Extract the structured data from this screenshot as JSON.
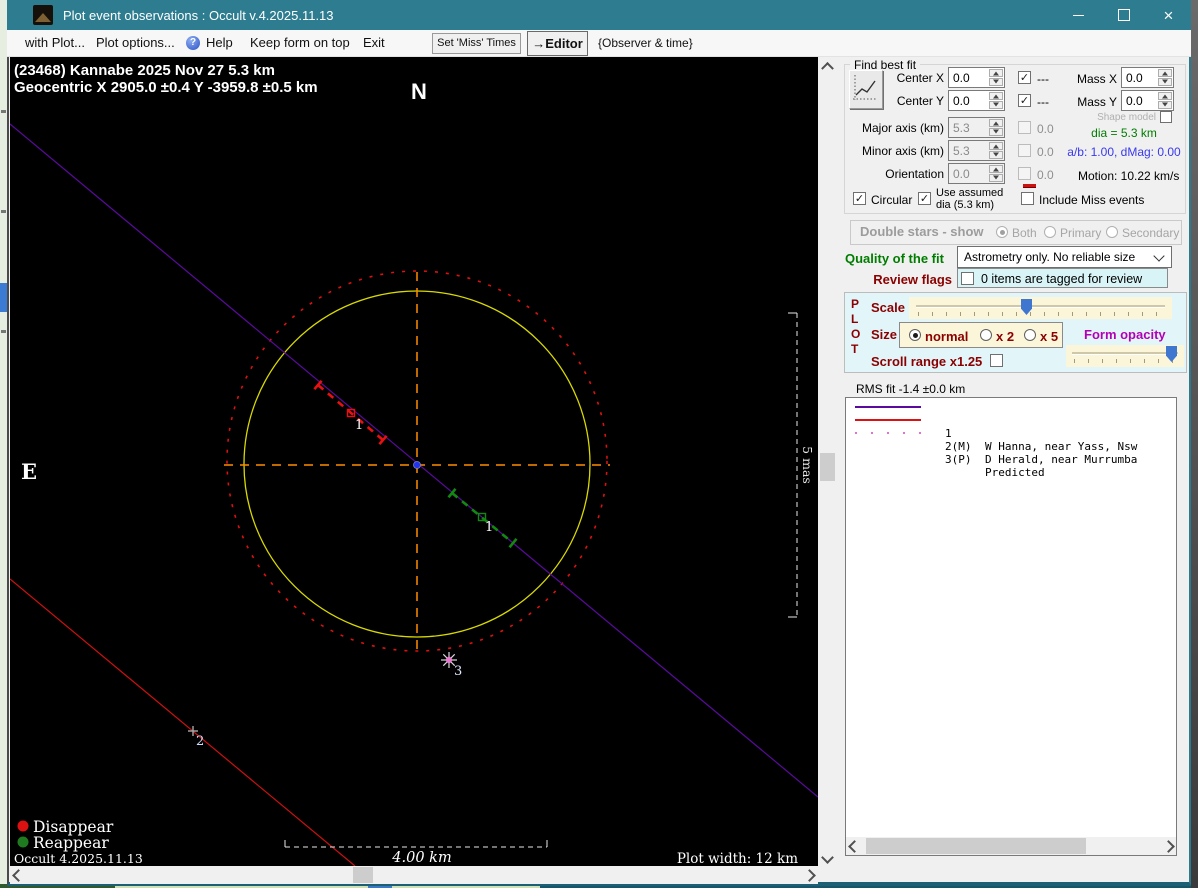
{
  "titlebar": {
    "title": "Plot event observations : Occult v.4.2025.11.13"
  },
  "menu": {
    "with_plot": "with Plot...",
    "plot_options": "Plot options...",
    "help": "Help",
    "keep_on_top": "Keep form on top",
    "exit": "Exit",
    "set_miss_times": "Set 'Miss' Times",
    "editor": "→Editor",
    "observer_time": "{Observer & time}"
  },
  "plot": {
    "header_line1": "(23468) Kannabe  2025 Nov 27   5.3 km",
    "header_line2": "Geocentric  X  2905.0 ±0.4  Y -3959.8 ±0.5 km",
    "compass_north": "N",
    "compass_east": "E",
    "chord1_disappear_label": "1",
    "chord1_reappear_label": "1",
    "miss_chord_label": "2",
    "predicted_label": "3",
    "vertical_scale": "5 mas",
    "horizontal_scale": "4.00 km",
    "plot_width": "Plot width: 12 km",
    "version": "Occult 4.2025.11.13",
    "legend_disappear": "Disappear",
    "legend_reappear": "Reappear"
  },
  "find_best_fit": {
    "title": "Find best fit",
    "center_x_label": "Center X",
    "center_x": "0.0",
    "center_x_flag": "---",
    "center_y_label": "Center Y",
    "center_y": "0.0",
    "center_y_flag": "---",
    "mass_x_label": "Mass X",
    "mass_x": "0.0",
    "mass_y_label": "Mass Y",
    "mass_y": "0.0",
    "shape_model_label": "Shape model",
    "major_axis_label": "Major axis (km)",
    "major_axis": "5.3",
    "major_axis_alt": "0.0",
    "minor_axis_label": "Minor axis (km)",
    "minor_axis": "5.3",
    "minor_axis_alt": "0.0",
    "orientation_label": "Orientation",
    "orientation": "0.0",
    "orientation_alt": "0.0",
    "dia_text": "dia = 5.3 km",
    "ab_text": "a/b: 1.00, dMag: 0.00",
    "motion_text": "Motion: 10.22 km/s",
    "circular_label": "Circular",
    "use_assumed_label": "Use assumed dia (5.3 km)",
    "include_miss_label": "Include Miss events"
  },
  "double_stars": {
    "title": "Double stars - show",
    "both": "Both",
    "primary": "Primary",
    "secondary": "Secondary"
  },
  "quality": {
    "label": "Quality of the fit",
    "value": "Astrometry only. No reliable size"
  },
  "review": {
    "label": "Review flags",
    "text": "0 items are tagged for review"
  },
  "plot_controls": {
    "letters": [
      "P",
      "L",
      "O",
      "T"
    ],
    "scale_label": "Scale",
    "size_label": "Size",
    "size_normal": "normal",
    "size_x2": "x 2",
    "size_x5": "x 5",
    "form_opacity_label": "Form opacity",
    "scroll_range_label": "Scroll range x1.25"
  },
  "rms_text": "RMS fit -1.4 ±0.0 km",
  "observers": [
    {
      "num": "1",
      "name": "W Hanna, near Yass, Nsw"
    },
    {
      "num": "2(M)",
      "name": "D Herald, near Murrumba"
    },
    {
      "num": "3(P)",
      "name": "Predicted"
    }
  ],
  "colors": {
    "titlebar": "#2d7c90",
    "fitted_circle": "#d9d900",
    "uncertainty_circle": "#dd1111",
    "crosshair": "#ff8c00",
    "chord_path": "#5a0b9d",
    "miss_path": "#cc1111",
    "disappear": "#dd1111",
    "reappear": "#1f7a1f",
    "predicted_marker": "#e87ad0",
    "label_dark_red": "#8b0000",
    "label_green": "#007d00",
    "label_magenta": "#b400b4",
    "value_blue": "#3939ee",
    "slider_thumb": "#3f76cf"
  }
}
